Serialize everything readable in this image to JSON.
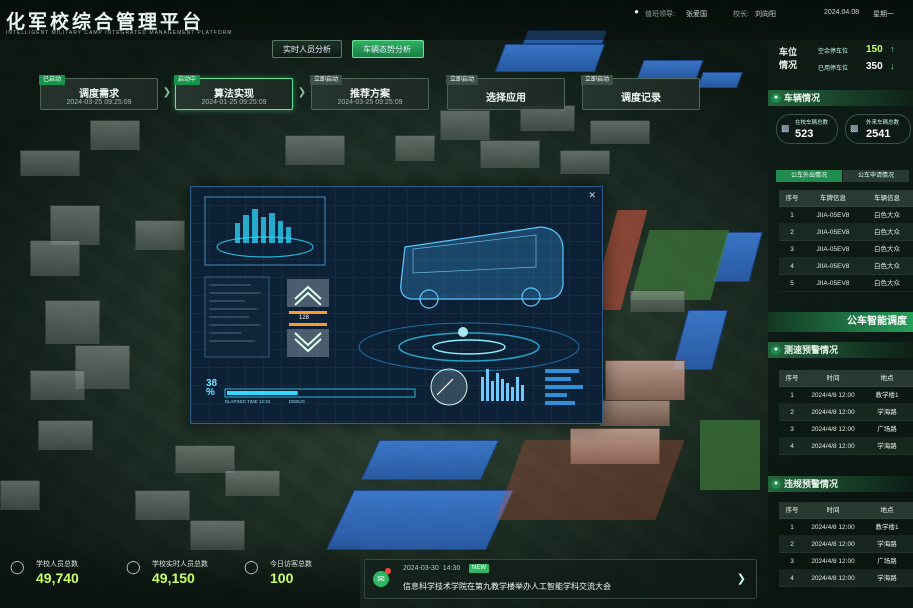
{
  "header": {
    "title": "化军校综合管理平台",
    "subtitle": "INTELLIGENT MILITARY CAMP INTEGRATED MANAGEMENT PLATFORM",
    "leader_label": "值班领导:",
    "leader_name": "张爱国",
    "school_label": "校长:",
    "school_name": "刘向阳",
    "date": "2024.04.08",
    "weekday": "星期一"
  },
  "tabs": [
    {
      "label": "实时人员分析"
    },
    {
      "label": "车辆态势分析"
    }
  ],
  "steps": [
    {
      "tag": "已启动",
      "label": "调度需求",
      "time": "2024-03-25 09:25:09"
    },
    {
      "tag": "启动中",
      "label": "算法实现",
      "time": "2024-01-25 09:25:09"
    },
    {
      "tag": "立即启动",
      "label": "推荐方案",
      "time": "2024-03-25 09:25:09"
    },
    {
      "tag": "立即启动",
      "label": "选择应用",
      "time": ""
    },
    {
      "tag": "立即启动",
      "label": "调度记录",
      "time": ""
    }
  ],
  "parking": {
    "title": "车位\n情况",
    "free_label": "空余停车位",
    "free_value": "150",
    "used_label": "已用停车位",
    "used_value": "350"
  },
  "vehicles": {
    "title": "车辆情况",
    "in_label": "在校车辆总数",
    "in_value": "523",
    "out_label": "外来车辆总数",
    "out_value": "2541",
    "tab_a": "公车外出情况",
    "tab_b": "公车申请情况",
    "headers": [
      "序号",
      "车牌信息",
      "车辆信息"
    ],
    "rows": [
      [
        "1",
        "JIIA-05EV8",
        "白色大众"
      ],
      [
        "2",
        "JIIA-05EV8",
        "白色大众"
      ],
      [
        "3",
        "JIIA-05EV8",
        "白色大众"
      ],
      [
        "4",
        "JIIA-05EV8",
        "白色大众"
      ],
      [
        "5",
        "JIIA-05EV8",
        "白色大众"
      ]
    ]
  },
  "dispatch_title": "公车智能调度",
  "speed_alerts": {
    "title": "测速预警情况",
    "headers": [
      "序号",
      "时间",
      "地点"
    ],
    "rows": [
      [
        "1",
        "2024/4/8 12:00",
        "教学楼1"
      ],
      [
        "2",
        "2024/4/8 12:00",
        "学海路"
      ],
      [
        "3",
        "2024/4/8 12:00",
        "广场路"
      ],
      [
        "4",
        "2024/4/8 12:00",
        "学海路"
      ]
    ]
  },
  "violation_alerts": {
    "title": "违规预警情况",
    "headers": [
      "序号",
      "时间",
      "地点"
    ],
    "rows": [
      [
        "1",
        "2024/4/8 12:00",
        "教学楼1"
      ],
      [
        "2",
        "2024/4/8 12:00",
        "学海路"
      ],
      [
        "3",
        "2024/4/8 12:00",
        "广场路"
      ],
      [
        "4",
        "2024/4/8 12:00",
        "学海路"
      ]
    ]
  },
  "stats": [
    {
      "label": "学校人员总数",
      "value": "49,740"
    },
    {
      "label": "学校实时人员总数",
      "value": "49,150"
    },
    {
      "label": "今日访客总数",
      "value": "100"
    }
  ],
  "notice": {
    "time": "2024-03-30  14:30",
    "badge": "NEW",
    "text": "信息科学技术学院在第九教学楼举办人工智能学科交流大会"
  },
  "hud": {
    "percent": "38",
    "percent_sign": "%",
    "elapsed": "ELAPSED TIME 12:34",
    "counter": "128",
    "label": "DEBUG"
  },
  "colors": {
    "accent": "#1f9d55",
    "value": "#c8ff66",
    "panel_blue": "#2e5c86"
  }
}
